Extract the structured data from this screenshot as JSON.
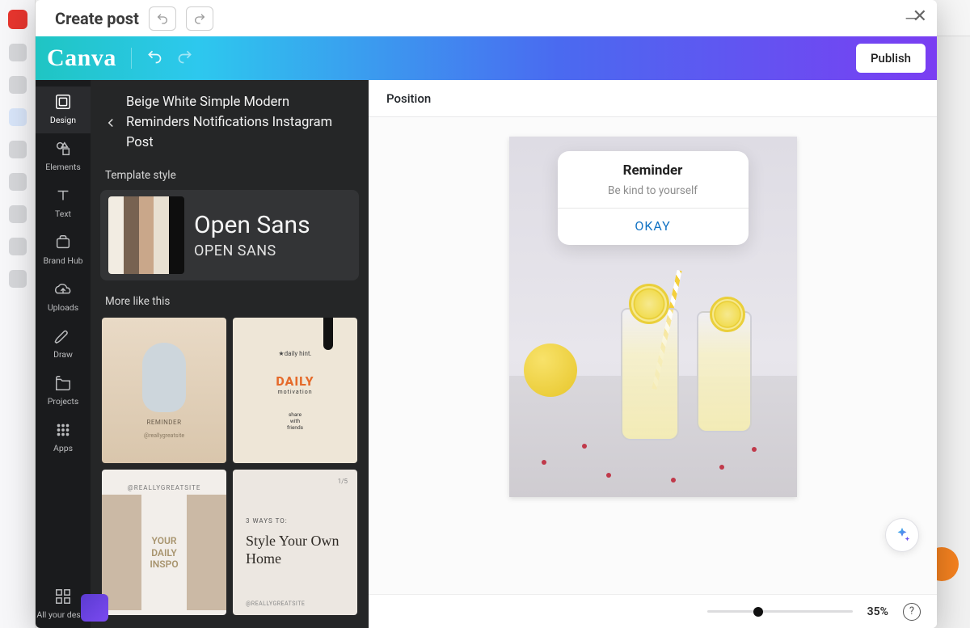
{
  "host": {
    "title": "Create post"
  },
  "canva": {
    "logo": "Canva",
    "publish": "Publish"
  },
  "rail": {
    "items": [
      {
        "label": "Design"
      },
      {
        "label": "Elements"
      },
      {
        "label": "Text"
      },
      {
        "label": "Brand Hub"
      },
      {
        "label": "Uploads"
      },
      {
        "label": "Draw"
      },
      {
        "label": "Projects"
      },
      {
        "label": "Apps"
      }
    ],
    "footer": {
      "label": "All your desi..."
    }
  },
  "panel": {
    "templateName": "Beige White Simple Modern Reminders Notifications Instagram Post",
    "styleLabel": "Template style",
    "fontPrimary": "Open Sans",
    "fontSecondary": "OPEN SANS",
    "palette": [
      "#f2ece2",
      "#776251",
      "#c9a78a",
      "#e8e0d2",
      "#0e0e0e"
    ],
    "moreLabel": "More like this",
    "thumbs": {
      "t1": {
        "caption": "REMINDER",
        "handle": "@reallygreatsite"
      },
      "t2": {
        "brand": "★daily hint.",
        "word": "DAILY",
        "sub": "motivation",
        "share": "share\nwith\nfriends"
      },
      "t3": {
        "header": "@REALLYGREATSITE",
        "line1": "YOUR",
        "line2": "DAILY",
        "line3": "INSPO"
      },
      "t4": {
        "kicker": "3 WAYS TO:",
        "title": "Style Your Own Home",
        "page": "1/5",
        "site": "@REALLYGREATSITE"
      }
    }
  },
  "toolbar": {
    "position": "Position"
  },
  "artboard": {
    "reminder": {
      "title": "Reminder",
      "body": "Be kind to yourself",
      "ok": "OKAY"
    }
  },
  "footer": {
    "zoomPercent": 35,
    "zoomLabel": "35%"
  }
}
